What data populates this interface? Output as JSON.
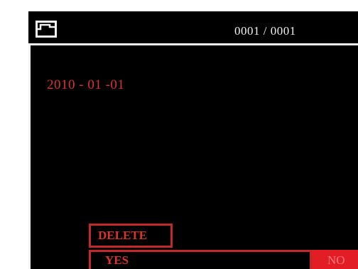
{
  "header": {
    "icon": "folder-icon",
    "counter": "0001 / 0001"
  },
  "record": {
    "date": "2010 - 01 -01"
  },
  "dialog": {
    "title": "DELETE",
    "yes_label": "YES",
    "no_label": "NO"
  },
  "colors": {
    "screen_bg": "#000000",
    "frame": "#f2f2f2",
    "accent_red": "#d9342c",
    "selected_bg": "#e21d25"
  }
}
